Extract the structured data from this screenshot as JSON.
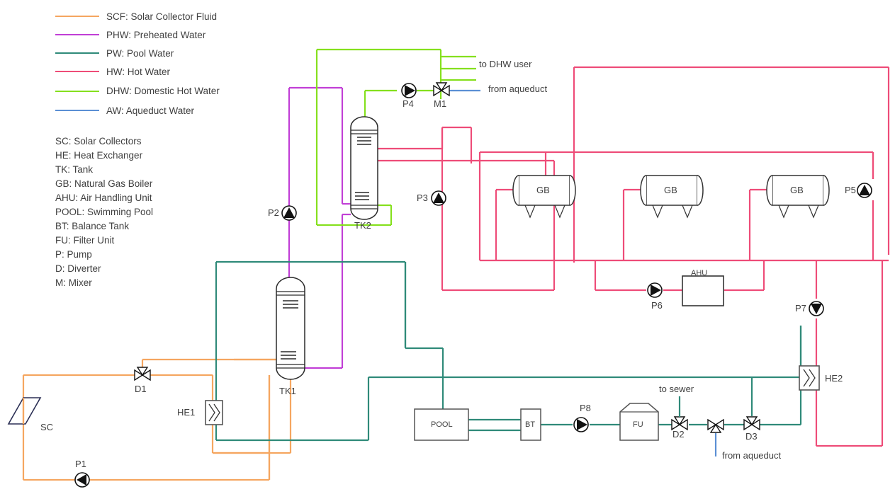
{
  "legend": {
    "items": [
      {
        "code": "SCF",
        "label": "SCF: Solar Collector Fluid",
        "color": "#f5a660"
      },
      {
        "code": "PHW",
        "label": "PHW: Preheated Water",
        "color": "#c13fd6"
      },
      {
        "code": "PW",
        "label": "PW: Pool Water",
        "color": "#2f8a79"
      },
      {
        "code": "HW",
        "label": "HW: Hot Water",
        "color": "#ee4c78"
      },
      {
        "code": "DHW",
        "label": "DHW: Domestic Hot Water",
        "color": "#85e01e"
      },
      {
        "code": "AW",
        "label": "AW: Aqueduct Water",
        "color": "#5b8fd4"
      }
    ]
  },
  "abbreviations": [
    "SC: Solar Collectors",
    "HE: Heat Exchanger",
    "TK: Tank",
    "GB: Natural Gas Boiler",
    "AHU: Air Handling Unit",
    "POOL: Swimming Pool",
    "BT: Balance Tank",
    "FU: Filter Unit",
    "P: Pump",
    "D: Diverter",
    "M: Mixer"
  ],
  "components": {
    "solar_collector": "SC",
    "heat_exchanger_1": "HE1",
    "heat_exchanger_2": "HE2",
    "tank_1": "TK1",
    "tank_2": "TK2",
    "boiler_1": "GB",
    "boiler_2": "GB",
    "boiler_3": "GB",
    "air_handling_unit": "AHU",
    "pool": "POOL",
    "balance_tank": "BT",
    "filter_unit": "FU"
  },
  "pumps": {
    "p1": "P1",
    "p2": "P2",
    "p3": "P3",
    "p4": "P4",
    "p5": "P5",
    "p6": "P6",
    "p7": "P7",
    "p8": "P8"
  },
  "valves": {
    "d1": "D1",
    "d2": "D2",
    "d3": "D3",
    "m1": "M1"
  },
  "annotations": {
    "to_dhw_user": "to DHW user",
    "from_aqueduct_top": "from aqueduct",
    "to_sewer": "to sewer",
    "from_aqueduct_bottom": "from aqueduct"
  },
  "colors": {
    "scf": "#f5a660",
    "phw": "#c13fd6",
    "pw": "#2f8a79",
    "hw": "#ee4c78",
    "dhw": "#85e01e",
    "aw": "#5b8fd4",
    "outline": "#3f3f3f",
    "equipment_stroke": "#555555"
  }
}
